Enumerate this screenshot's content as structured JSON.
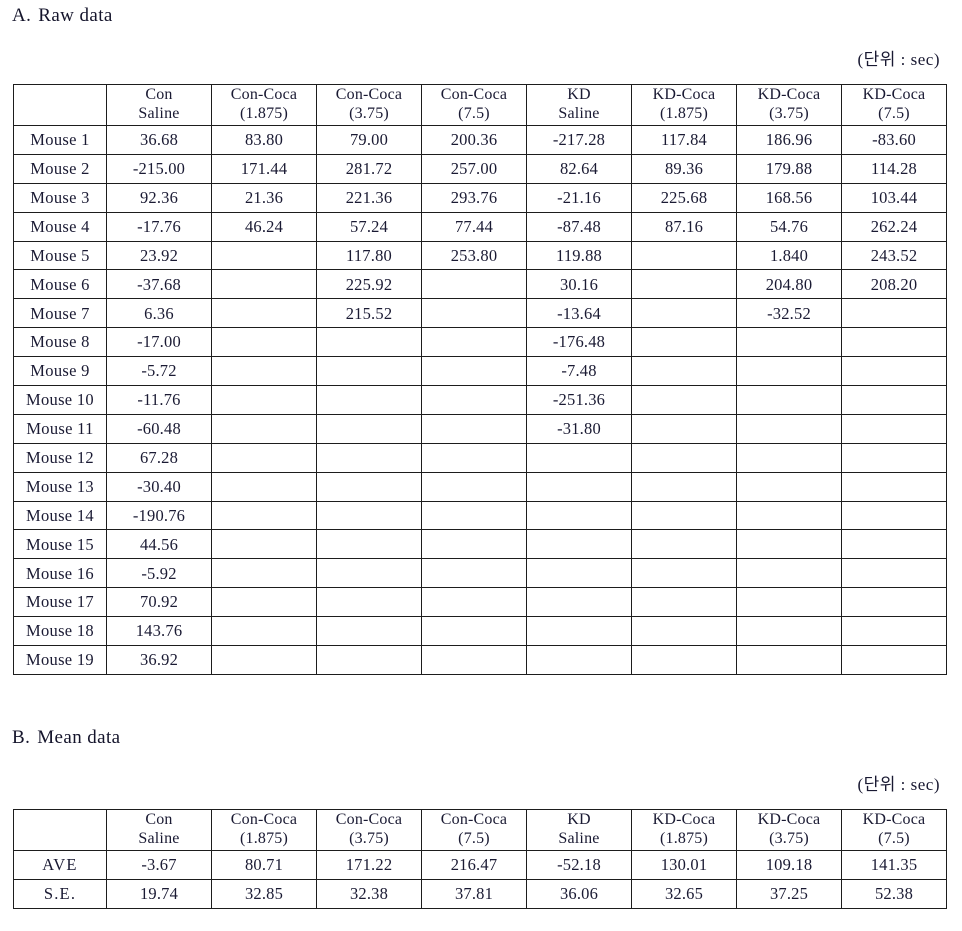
{
  "document": {
    "unit_note": "(단위 : sec)"
  },
  "sections": {
    "a": {
      "letter": "A.",
      "title": "Raw data"
    },
    "b": {
      "letter": "B.",
      "title": "Mean data"
    }
  },
  "columns": [
    {
      "line1": "Con",
      "line2": "Saline"
    },
    {
      "line1": "Con-Coca",
      "line2": "(1.875)"
    },
    {
      "line1": "Con-Coca",
      "line2": "(3.75)"
    },
    {
      "line1": "Con-Coca",
      "line2": "(7.5)"
    },
    {
      "line1": "KD",
      "line2": "Saline"
    },
    {
      "line1": "KD-Coca",
      "line2": "(1.875)"
    },
    {
      "line1": "KD-Coca",
      "line2": "(3.75)"
    },
    {
      "line1": "KD-Coca",
      "line2": "(7.5)"
    }
  ],
  "raw_table": {
    "rows": [
      {
        "label": "Mouse 1",
        "values": [
          "36.68",
          "83.80",
          "79.00",
          "200.36",
          "-217.28",
          "117.84",
          "186.96",
          "-83.60"
        ]
      },
      {
        "label": "Mouse 2",
        "values": [
          "-215.00",
          "171.44",
          "281.72",
          "257.00",
          "82.64",
          "89.36",
          "179.88",
          "114.28"
        ]
      },
      {
        "label": "Mouse 3",
        "values": [
          "92.36",
          "21.36",
          "221.36",
          "293.76",
          "-21.16",
          "225.68",
          "168.56",
          "103.44"
        ]
      },
      {
        "label": "Mouse 4",
        "values": [
          "-17.76",
          "46.24",
          "57.24",
          "77.44",
          "-87.48",
          "87.16",
          "54.76",
          "262.24"
        ]
      },
      {
        "label": "Mouse 5",
        "values": [
          "23.92",
          "",
          "117.80",
          "253.80",
          "119.88",
          "",
          "1.840",
          "243.52"
        ]
      },
      {
        "label": "Mouse 6",
        "values": [
          "-37.68",
          "",
          "225.92",
          "",
          "30.16",
          "",
          "204.80",
          "208.20"
        ]
      },
      {
        "label": "Mouse 7",
        "values": [
          "6.36",
          "",
          "215.52",
          "",
          "-13.64",
          "",
          "-32.52",
          ""
        ]
      },
      {
        "label": "Mouse 8",
        "values": [
          "-17.00",
          "",
          "",
          "",
          "-176.48",
          "",
          "",
          ""
        ]
      },
      {
        "label": "Mouse 9",
        "values": [
          "-5.72",
          "",
          "",
          "",
          "-7.48",
          "",
          "",
          ""
        ]
      },
      {
        "label": "Mouse 10",
        "values": [
          "-11.76",
          "",
          "",
          "",
          "-251.36",
          "",
          "",
          ""
        ]
      },
      {
        "label": "Mouse 11",
        "values": [
          "-60.48",
          "",
          "",
          "",
          "-31.80",
          "",
          "",
          ""
        ]
      },
      {
        "label": "Mouse 12",
        "values": [
          "67.28",
          "",
          "",
          "",
          "",
          "",
          "",
          ""
        ]
      },
      {
        "label": "Mouse 13",
        "values": [
          "-30.40",
          "",
          "",
          "",
          "",
          "",
          "",
          ""
        ]
      },
      {
        "label": "Mouse 14",
        "values": [
          "-190.76",
          "",
          "",
          "",
          "",
          "",
          "",
          ""
        ]
      },
      {
        "label": "Mouse 15",
        "values": [
          "44.56",
          "",
          "",
          "",
          "",
          "",
          "",
          ""
        ]
      },
      {
        "label": "Mouse 16",
        "values": [
          "-5.92",
          "",
          "",
          "",
          "",
          "",
          "",
          ""
        ]
      },
      {
        "label": "Mouse 17",
        "values": [
          "70.92",
          "",
          "",
          "",
          "",
          "",
          "",
          ""
        ]
      },
      {
        "label": "Mouse 18",
        "values": [
          "143.76",
          "",
          "",
          "",
          "",
          "",
          "",
          ""
        ]
      },
      {
        "label": "Mouse 19",
        "values": [
          "36.92",
          "",
          "",
          "",
          "",
          "",
          "",
          ""
        ]
      }
    ]
  },
  "mean_table": {
    "rows": [
      {
        "label": "AVE",
        "values": [
          "-3.67",
          "80.71",
          "171.22",
          "216.47",
          "-52.18",
          "130.01",
          "109.18",
          "141.35"
        ]
      },
      {
        "label": "S.E.",
        "values": [
          "19.74",
          "32.85",
          "32.38",
          "37.81",
          "36.06",
          "32.65",
          "37.25",
          "52.38"
        ]
      }
    ]
  },
  "chart_data": {
    "type": "table",
    "title": "Raw data and Mean data (units: sec)",
    "categories": [
      "Con Saline",
      "Con-Coca (1.875)",
      "Con-Coca (3.75)",
      "Con-Coca (7.5)",
      "KD Saline",
      "KD-Coca (1.875)",
      "KD-Coca (3.75)",
      "KD-Coca (7.5)"
    ],
    "series": [
      {
        "name": "AVE",
        "values": [
          -3.67,
          80.71,
          171.22,
          216.47,
          -52.18,
          130.01,
          109.18,
          141.35
        ]
      },
      {
        "name": "S.E.",
        "values": [
          19.74,
          32.85,
          32.38,
          37.81,
          36.06,
          32.65,
          37.25,
          52.38
        ]
      }
    ],
    "ylabel": "sec",
    "xlabel": ""
  }
}
